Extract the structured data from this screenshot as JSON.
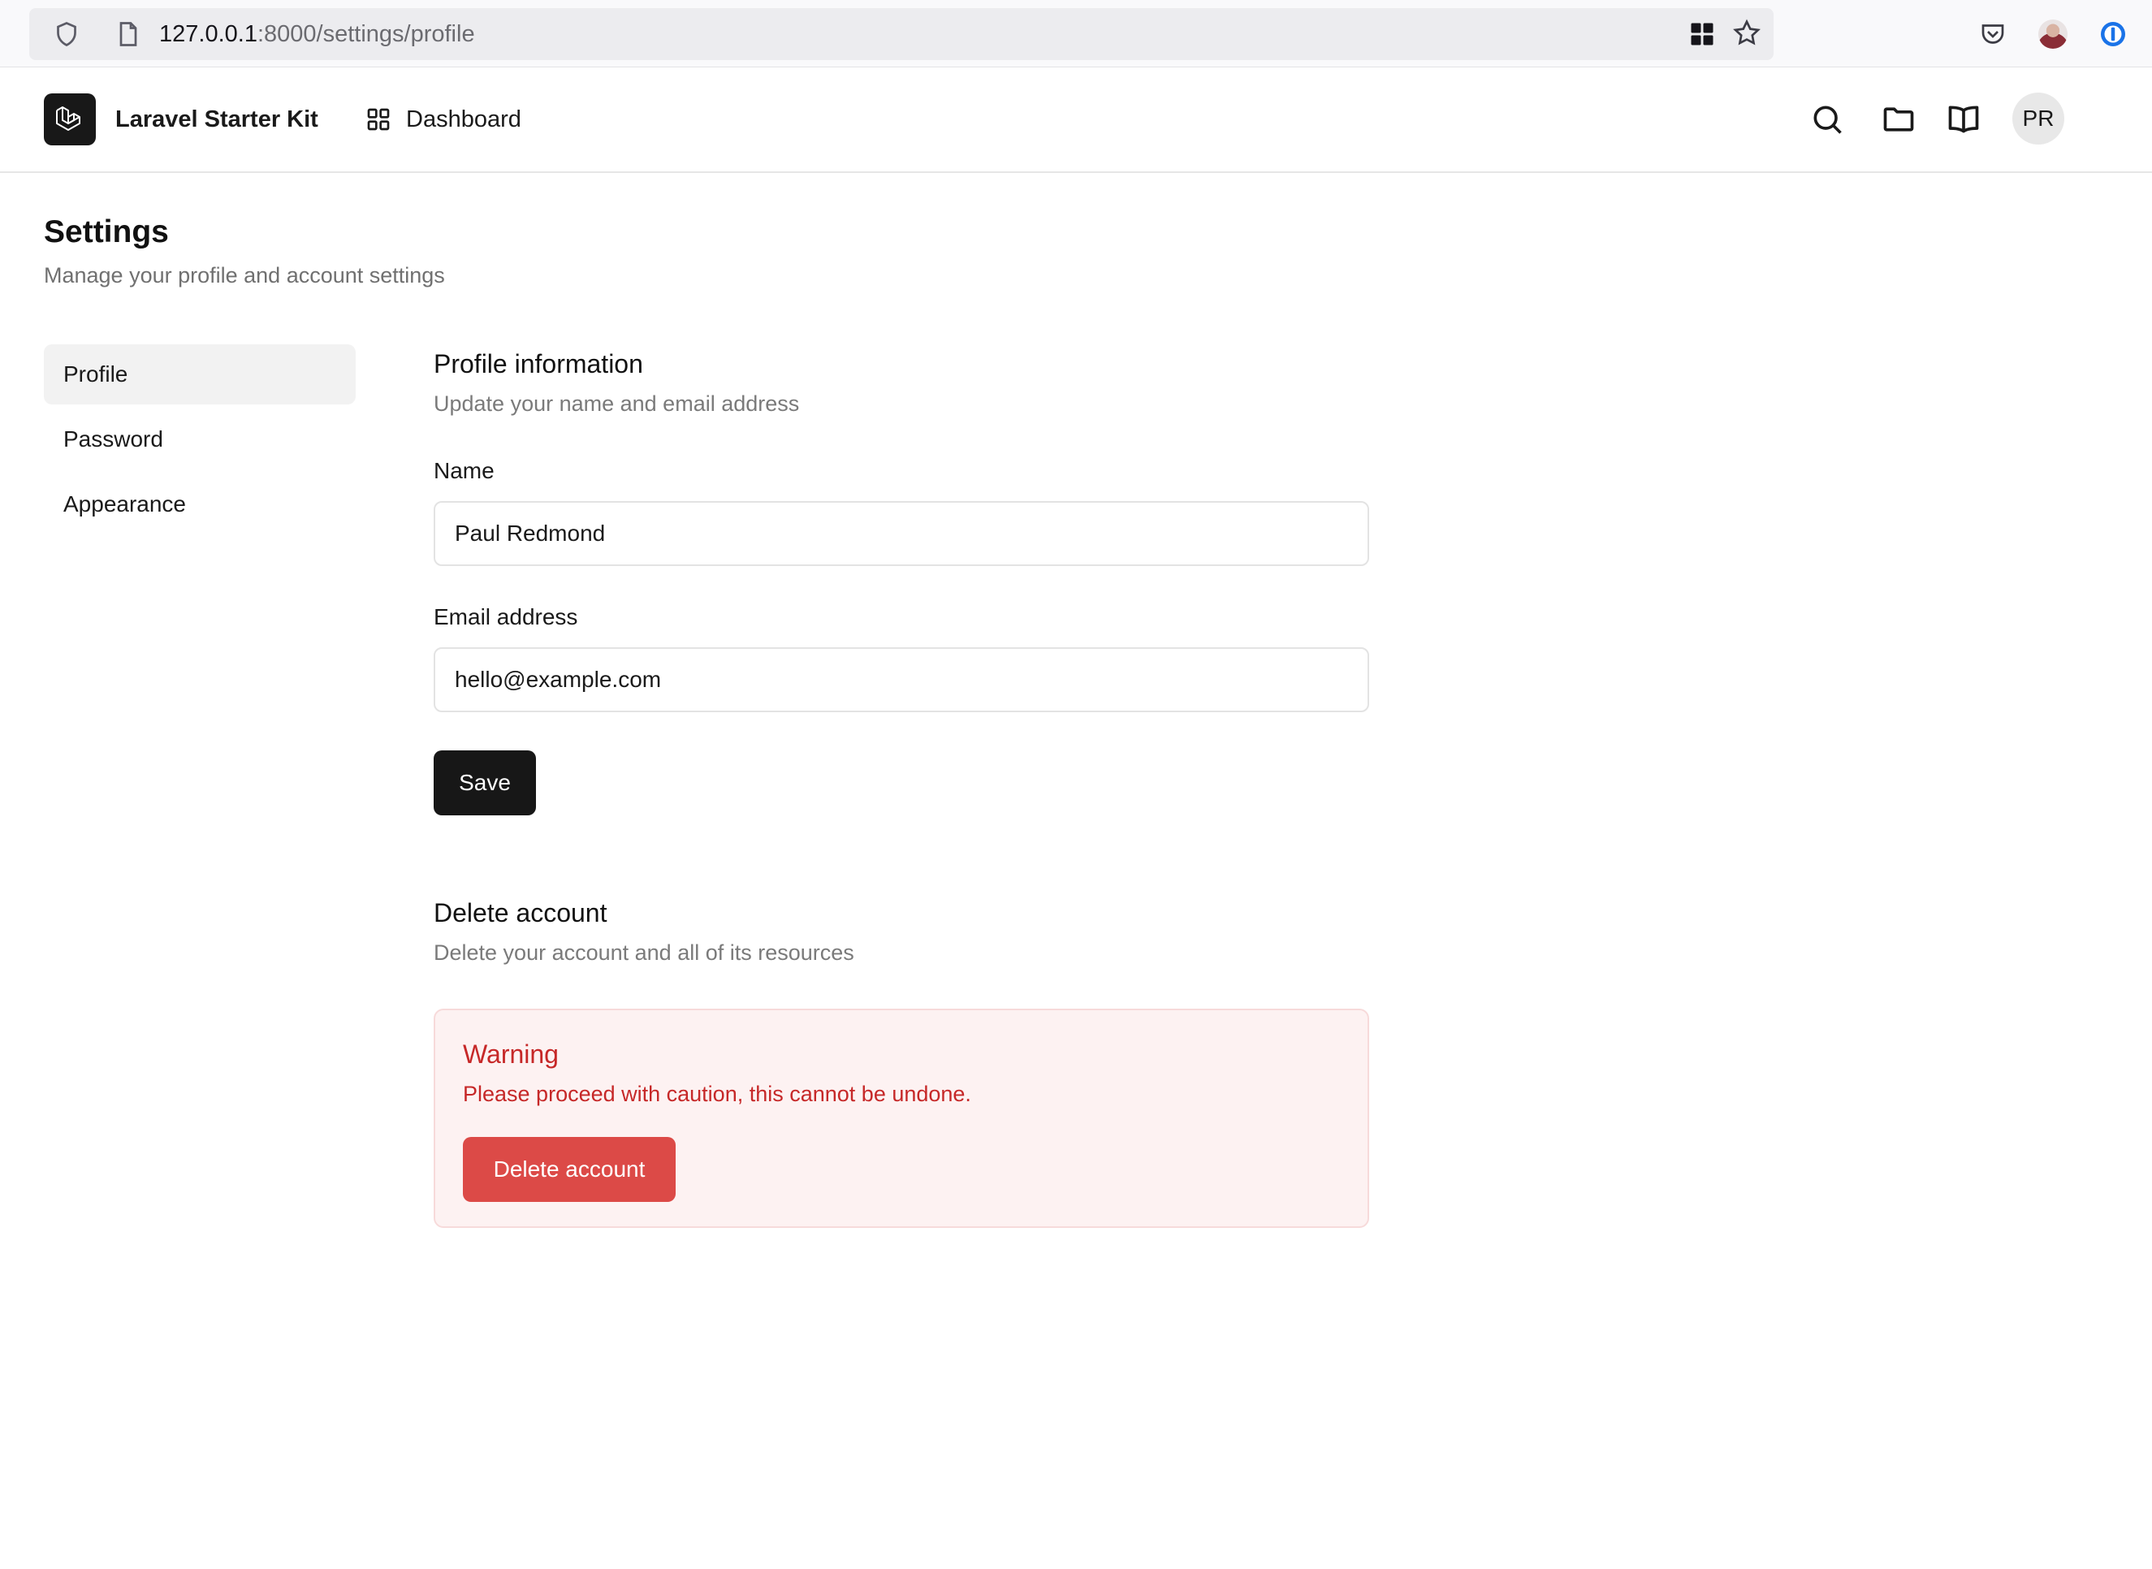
{
  "browser": {
    "url_host": "127.0.0.1",
    "url_path": ":8000/settings/profile"
  },
  "header": {
    "app_name": "Laravel Starter Kit",
    "nav_dashboard": "Dashboard",
    "avatar_initials": "PR",
    "icons": [
      "search-icon",
      "folder-icon",
      "book-open-icon"
    ]
  },
  "page": {
    "title": "Settings",
    "subtitle": "Manage your profile and account settings"
  },
  "sidebar": {
    "items": [
      {
        "label": "Profile",
        "active": true
      },
      {
        "label": "Password",
        "active": false
      },
      {
        "label": "Appearance",
        "active": false
      }
    ]
  },
  "profile": {
    "title": "Profile information",
    "subtitle": "Update your name and email address",
    "name_label": "Name",
    "name_value": "Paul Redmond",
    "email_label": "Email address",
    "email_value": "hello@example.com",
    "save_label": "Save"
  },
  "delete": {
    "title": "Delete account",
    "subtitle": "Delete your account and all of its resources",
    "warning_title": "Warning",
    "warning_text": "Please proceed with caution, this cannot be undone.",
    "button_label": "Delete account"
  },
  "colors": {
    "primary_button": "#171717",
    "danger": "#dc4a47",
    "warning_bg": "#fdf2f2",
    "warning_text": "#c62828"
  }
}
